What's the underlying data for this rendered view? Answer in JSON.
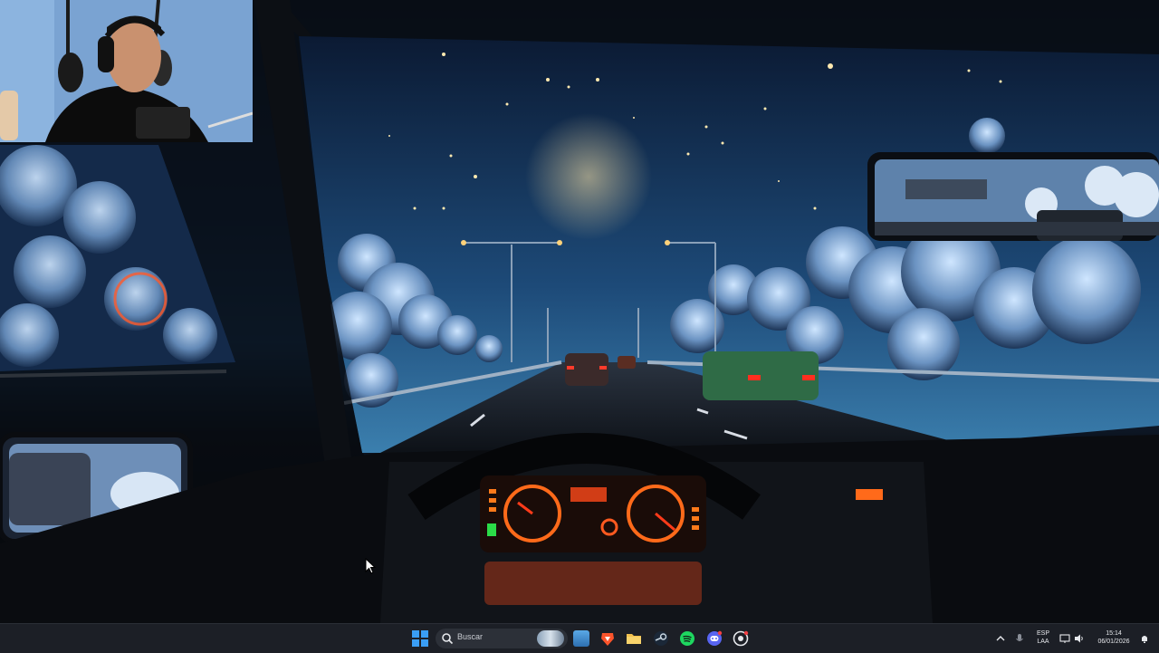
{
  "screen": {
    "wallpaper": "night highway drive with crescent moon, clouds and car dashboard",
    "webcam_overlay": "streamer webcam with headphones"
  },
  "taskbar": {
    "search_placeholder": "Buscar",
    "pinned": [
      {
        "name": "start-button",
        "icon": "windows-logo-icon"
      },
      {
        "name": "widgets",
        "icon": "landscape-icon"
      },
      {
        "name": "brave-browser",
        "icon": "brave-lion-icon"
      },
      {
        "name": "file-explorer",
        "icon": "folder-icon"
      },
      {
        "name": "steam",
        "icon": "steam-icon"
      },
      {
        "name": "spotify",
        "icon": "spotify-icon"
      },
      {
        "name": "discord",
        "icon": "discord-icon"
      },
      {
        "name": "chrome-like-app",
        "icon": "red-circle-icon"
      }
    ],
    "tray": {
      "language_top": "ESP",
      "language_bottom": "LAA",
      "time": "15:14",
      "date": "06/01/2026"
    }
  },
  "colors": {
    "taskbar_bg": "#1c1f26",
    "windows_blue": "#3a9ef5",
    "spotify_green": "#1ed760",
    "brave_orange": "#fb542b",
    "discord_blurple": "#5865f2",
    "dashboard_orange": "#ff6a1a"
  }
}
